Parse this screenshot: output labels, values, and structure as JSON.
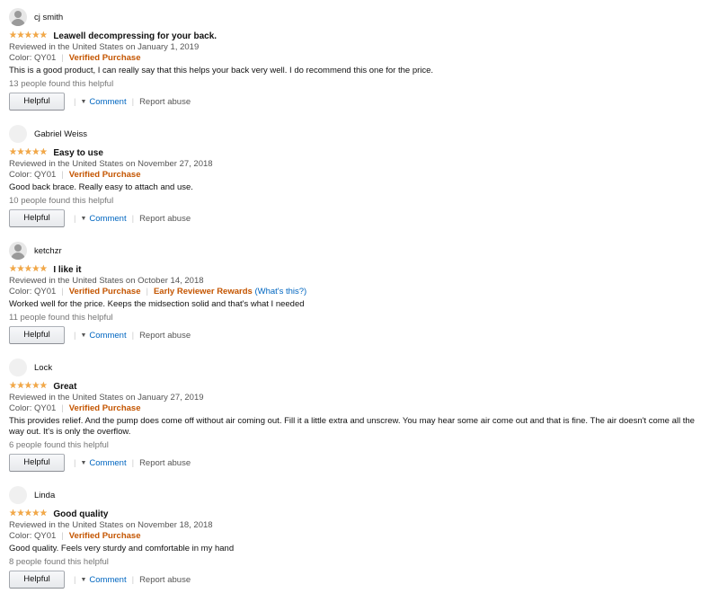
{
  "reviews": [
    {
      "profile_name": "cj smith",
      "avatar": "default-user-icon",
      "stars": "★★★★★",
      "title": "Leawell decompressing for your back.",
      "date": "Reviewed in the United States on January 1, 2019",
      "color": "Color: QY01",
      "verified": "Verified Purchase",
      "body": "This is a good product, I can really say that this helps your back very well. I do recommend this one for the price.",
      "helpful_count": "13 people found this helpful"
    },
    {
      "profile_name": "Gabriel Weiss",
      "avatar": "blank-avatar",
      "stars": "★★★★★",
      "title": "Easy to use",
      "date": "Reviewed in the United States on November 27, 2018",
      "color": "Color: QY01",
      "verified": "Verified Purchase",
      "body": "Good back brace. Really easy to attach and use.",
      "helpful_count": "10 people found this helpful"
    },
    {
      "profile_name": "ketchzr",
      "avatar": "default-user-icon",
      "stars": "★★★★★",
      "title": "I like it",
      "date": "Reviewed in the United States on October 14, 2018",
      "color": "Color: QY01",
      "verified": "Verified Purchase",
      "badge": "Early Reviewer Rewards",
      "badge_link": "(What's this?)",
      "body": "Worked well for the price. Keeps the midsection solid and that's what I needed",
      "helpful_count": "11 people found this helpful"
    },
    {
      "profile_name": "Lock",
      "avatar": "blank-avatar",
      "stars": "★★★★★",
      "title": "Great",
      "date": "Reviewed in the United States on January 27, 2019",
      "color": "Color: QY01",
      "verified": "Verified Purchase",
      "body": "This provides relief. And the pump does come off without air coming out. Fill it a little extra and unscrew. You may hear some air come out and that is fine. The air doesn't come all the way out. It's is only the overflow.",
      "helpful_count": "6 people found this helpful"
    },
    {
      "profile_name": "Linda",
      "avatar": "blank-avatar",
      "stars": "★★★★★",
      "title": "Good quality",
      "date": "Reviewed in the United States on November 18, 2018",
      "color": "Color: QY01",
      "verified": "Verified Purchase",
      "body": "Good quality. Feels very sturdy and comfortable in my hand",
      "helpful_count": "8 people found this helpful"
    }
  ],
  "actions": {
    "helpful_label": "Helpful",
    "comment_label": "Comment",
    "report_label": "Report abuse",
    "caret_icon": "caret-down-icon"
  },
  "colors": {
    "star": "#f3a847",
    "verified": "#c45500",
    "link": "#0066c0",
    "meta": "#555555"
  }
}
